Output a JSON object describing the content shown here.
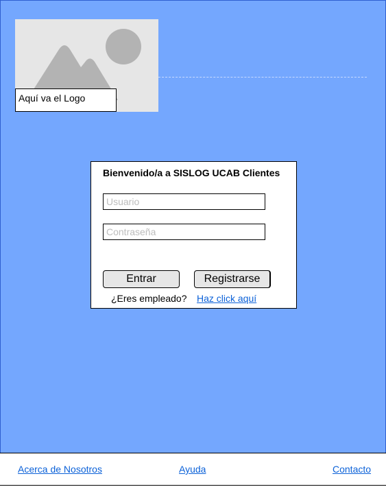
{
  "logo": {
    "caption": "Aquí va el Logo"
  },
  "login": {
    "welcome": "Bienvenido/a a SISLOG UCAB Clientes",
    "username_placeholder": "Usuario",
    "password_placeholder": "Contraseña",
    "login_button": "Entrar",
    "register_button": "Registrarse",
    "employee_question": "¿Eres empleado?",
    "employee_link": "Haz click aquí"
  },
  "footer": {
    "about": "Acerca de Nosotros",
    "help": "Ayuda",
    "contact": "Contacto"
  },
  "colors": {
    "background": "#74a7fe",
    "link": "#0b61d8",
    "button": "#e6e6e6"
  }
}
